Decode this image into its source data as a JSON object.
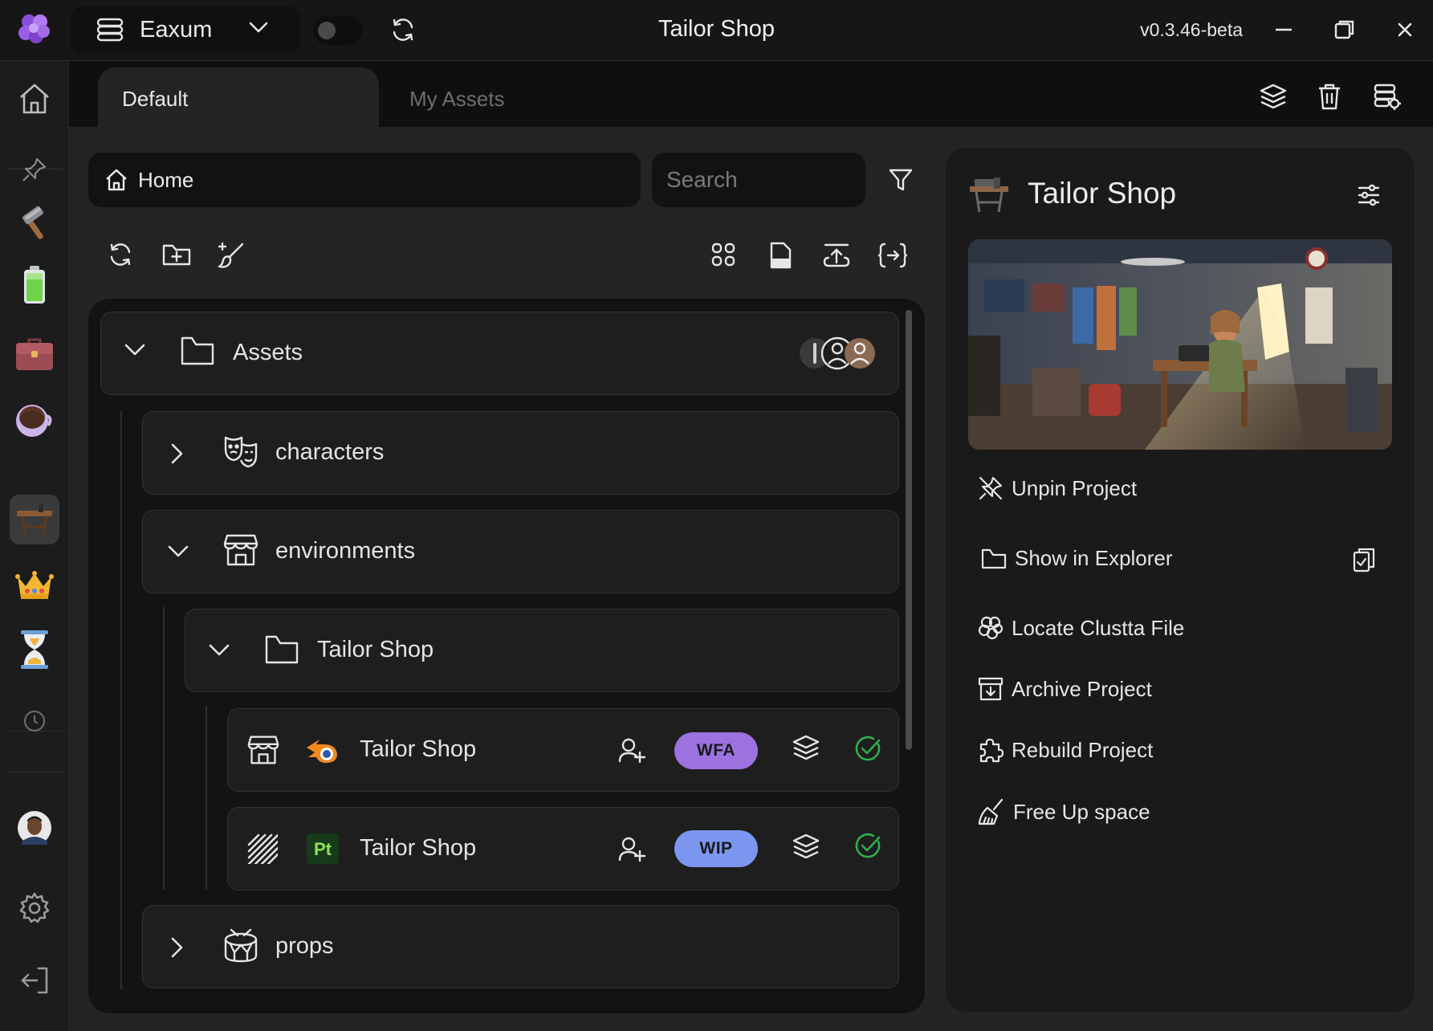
{
  "titlebar": {
    "workspace": "Eaxum",
    "title": "Tailor Shop",
    "version": "v0.3.46-beta"
  },
  "tabs": [
    {
      "label": "Default",
      "active": true
    },
    {
      "label": "My Assets",
      "active": false
    }
  ],
  "breadcrumb": {
    "label": "Home"
  },
  "search": {
    "placeholder": "Search"
  },
  "tree": {
    "root": {
      "label": "Assets",
      "expanded": true
    },
    "folders": [
      {
        "label": "characters",
        "expanded": false,
        "icon": "theater-masks-icon"
      },
      {
        "label": "environments",
        "expanded": true,
        "icon": "storefront-icon"
      },
      {
        "label": "Tailor Shop",
        "expanded": true,
        "icon": "folder-icon"
      },
      {
        "label": "props",
        "expanded": false,
        "icon": "drum-icon"
      }
    ],
    "files": [
      {
        "label": "Tailor Shop",
        "app": "blender-icon",
        "status": "WFA",
        "status_color": "#9b72e0"
      },
      {
        "label": "Tailor Shop",
        "app": "Pt",
        "status": "WIP",
        "status_color": "#7b96ee"
      }
    ]
  },
  "side_panel": {
    "title": "Tailor Shop",
    "actions": [
      {
        "label": "Unpin Project",
        "icon": "unpin-icon"
      },
      {
        "label": "Show in Explorer",
        "icon": "folder-icon"
      },
      {
        "label": "Locate Clustta File",
        "icon": "clustta-icon"
      },
      {
        "label": "Archive Project",
        "icon": "archive-icon"
      },
      {
        "label": "Rebuild Project",
        "icon": "puzzle-icon"
      },
      {
        "label": "Free Up space",
        "icon": "broom-icon"
      }
    ]
  },
  "colors": {
    "accent_purple": "#9b72e0",
    "accent_blue": "#7b96ee",
    "check_green": "#2fae4e"
  }
}
